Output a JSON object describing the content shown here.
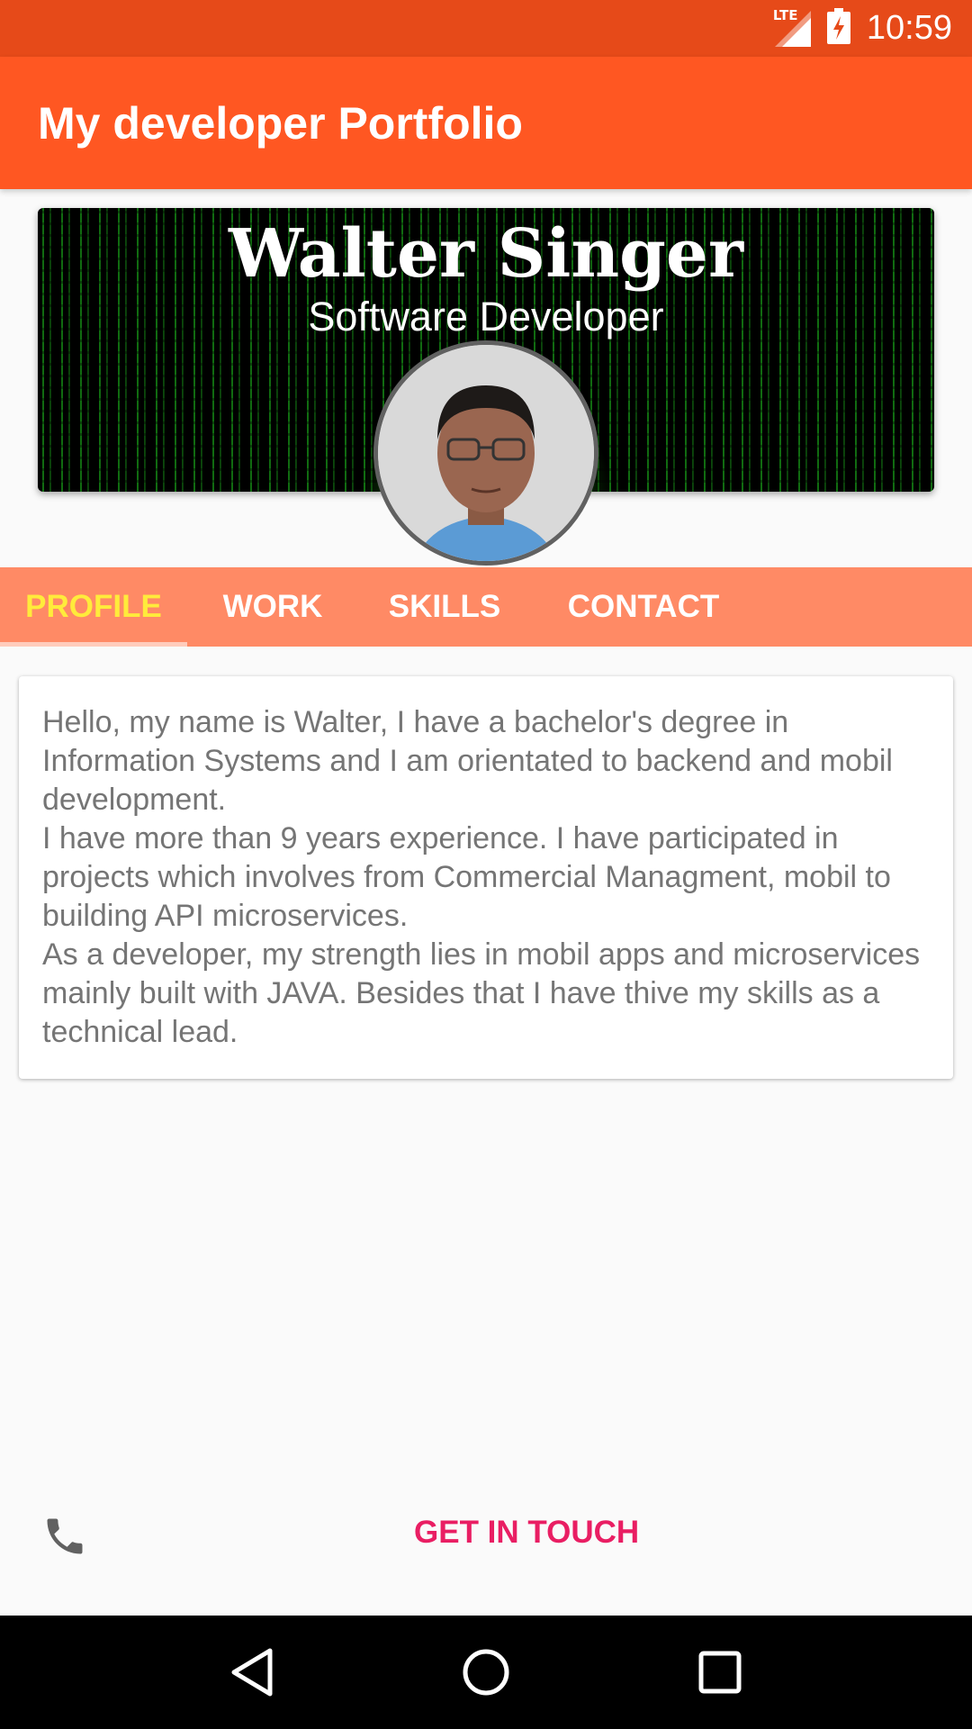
{
  "status_bar": {
    "network": "LTE",
    "time": "10:59"
  },
  "app_bar": {
    "title": "My developer Portfolio"
  },
  "header": {
    "name": "Walter Singer",
    "role": "Software Developer"
  },
  "tabs": [
    {
      "label": "PROFILE",
      "selected": true
    },
    {
      "label": "WORK",
      "selected": false
    },
    {
      "label": "SKILLS",
      "selected": false
    },
    {
      "label": "CONTACT",
      "selected": false
    }
  ],
  "profile": {
    "about": "Hello, my name is Walter, I have a bachelor's degree in Information Systems and I am orientated to backend and mobil development.\n I have more than 9 years experience. I have participated in projects which involves from Commercial Managment, mobil to building API microservices.\n As a developer, my strength lies in mobil apps and microservices mainly built with JAVA. Besides that I have thive my skills as a technical lead."
  },
  "action": {
    "label": "GET IN TOUCH",
    "icon": "phone-icon"
  },
  "colors": {
    "status_bar": "#e64a19",
    "app_bar": "#ff5722",
    "tab_bar": "#ff8a65",
    "tab_active_text": "#ffeb3b",
    "action_text": "#e91e63"
  }
}
